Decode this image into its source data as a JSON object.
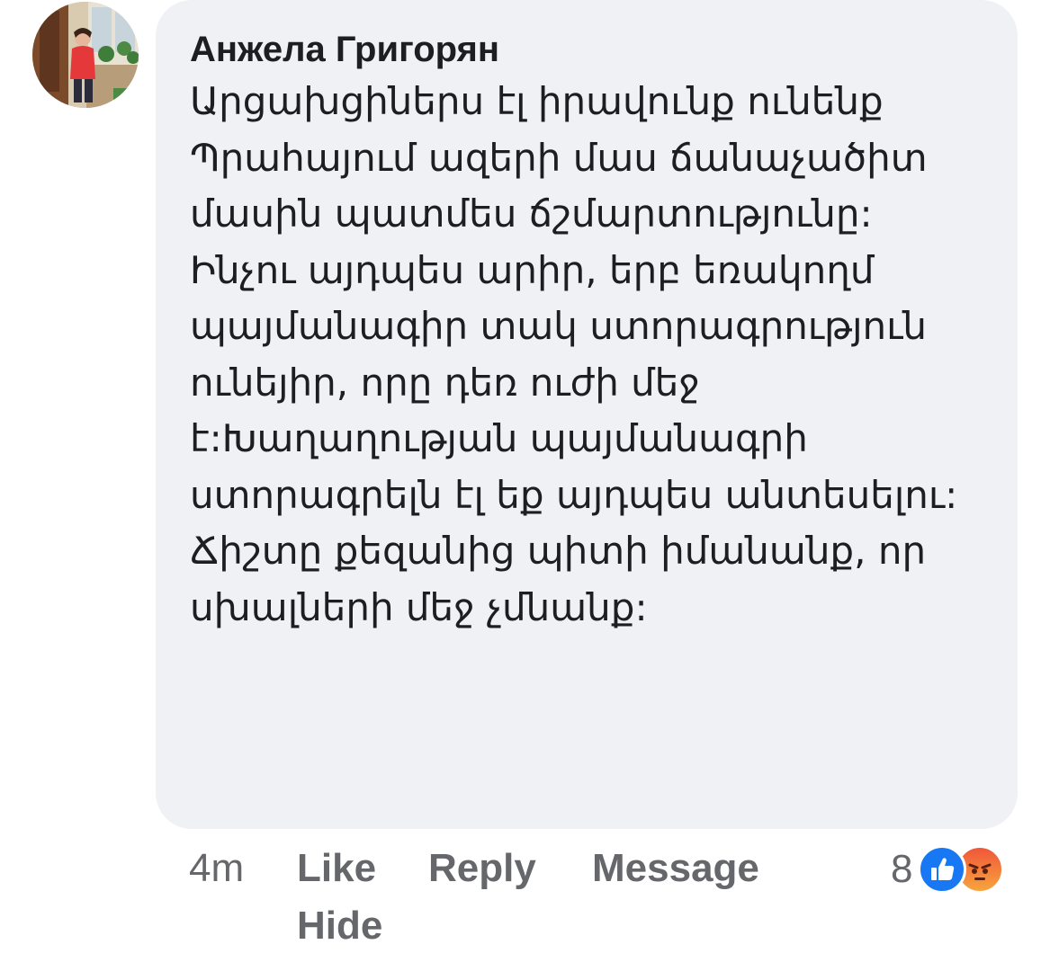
{
  "comment": {
    "author": "Анжела Григорян",
    "text": "Արցախցիներս էլ իրավունք ունենք Պրահայում ազերի մաս ճանաչածիտ մասին պատմես ճշմարտությունը: Ինչու այդպես արիր, երբ եռակողմ պայմանագիր տակ ստորագրություն ունեյիր, որը դեռ ուժի մեջ է:Խաղաղության պայմանագրի ստորագրելն էլ եք այդպես անտեսելու:\nՃիշտը քեզանից պիտի իմանանք, որ սխալների մեջ չմնանք:",
    "avatar_icon": "profile-photo"
  },
  "actions": {
    "time": "4m",
    "like": "Like",
    "reply": "Reply",
    "message": "Message",
    "hide": "Hide"
  },
  "reactions": {
    "count": "8",
    "types": [
      "like-icon",
      "angry-icon"
    ],
    "like_color": "#1877f2",
    "angry_color": "#f0573a"
  },
  "colors": {
    "bubble_bg": "#f0f1f4",
    "text": "#1c1e21",
    "meta": "#65676b"
  }
}
